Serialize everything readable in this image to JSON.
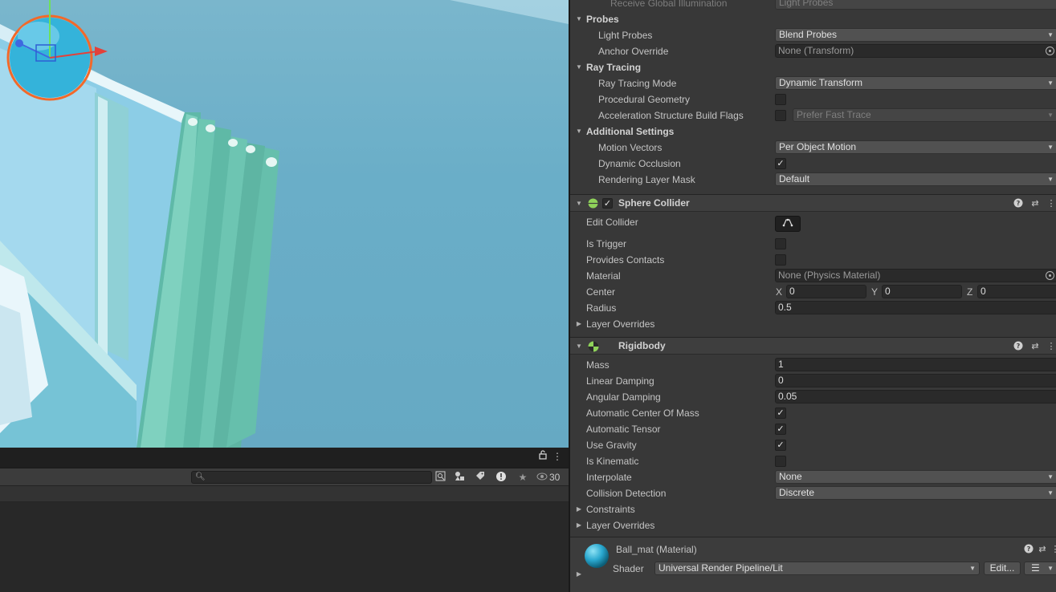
{
  "scene": {
    "icons": {
      "gizmo": "sphere-gizmo-icon"
    },
    "colors": {
      "sky": "#6aaec8",
      "radiator": "#6fc4b4",
      "selection": "#f26b22",
      "sphere": "#3bb5dc"
    }
  },
  "bottom_panel": {
    "lock_icon": "lock-icon",
    "menu_icon": "kebab-menu-icon",
    "search": {
      "value": "",
      "placeholder": ""
    },
    "hidden_count": "30",
    "toolbar_icons": [
      "search-filter-icon",
      "type-filter-icon",
      "label-filter-icon",
      "error-filter-icon",
      "favorite-filter-icon",
      "visibility-icon"
    ]
  },
  "inspector": {
    "renderer": {
      "receive_gi": {
        "label": "Receive Global Illumination",
        "value": "Light Probes"
      },
      "probes": {
        "header": "Probes",
        "light_probes": {
          "label": "Light Probes",
          "value": "Blend Probes"
        },
        "anchor_override": {
          "label": "Anchor Override",
          "value": "None (Transform)"
        }
      },
      "ray_tracing": {
        "header": "Ray Tracing",
        "mode": {
          "label": "Ray Tracing Mode",
          "value": "Dynamic Transform"
        },
        "procedural": {
          "label": "Procedural Geometry",
          "checked": false
        },
        "accel": {
          "label": "Acceleration Structure Build Flags",
          "value": "Prefer Fast Trace",
          "checked": false
        }
      },
      "additional": {
        "header": "Additional Settings",
        "motion_vectors": {
          "label": "Motion Vectors",
          "value": "Per Object Motion"
        },
        "dynamic_occlusion": {
          "label": "Dynamic Occlusion",
          "checked": true
        },
        "rendering_layer_mask": {
          "label": "Rendering Layer Mask",
          "value": "Default"
        }
      }
    },
    "sphere_collider": {
      "title": "Sphere Collider",
      "enabled": true,
      "edit_collider": {
        "label": "Edit Collider"
      },
      "is_trigger": {
        "label": "Is Trigger",
        "checked": false
      },
      "provides_contacts": {
        "label": "Provides Contacts",
        "checked": false
      },
      "material": {
        "label": "Material",
        "value": "None (Physics Material)"
      },
      "center": {
        "label": "Center",
        "x_label": "X",
        "x": "0",
        "y_label": "Y",
        "y": "0",
        "z_label": "Z",
        "z": "0"
      },
      "radius": {
        "label": "Radius",
        "value": "0.5"
      },
      "layer_overrides": {
        "label": "Layer Overrides"
      }
    },
    "rigidbody": {
      "title": "Rigidbody",
      "mass": {
        "label": "Mass",
        "value": "1"
      },
      "linear_damping": {
        "label": "Linear Damping",
        "value": "0"
      },
      "angular_damping": {
        "label": "Angular Damping",
        "value": "0.05"
      },
      "auto_center": {
        "label": "Automatic Center Of Mass",
        "checked": true
      },
      "auto_tensor": {
        "label": "Automatic Tensor",
        "checked": true
      },
      "use_gravity": {
        "label": "Use Gravity",
        "checked": true
      },
      "is_kinematic": {
        "label": "Is Kinematic",
        "checked": false
      },
      "interpolate": {
        "label": "Interpolate",
        "value": "None"
      },
      "collision_detection": {
        "label": "Collision Detection",
        "value": "Discrete"
      },
      "constraints": {
        "label": "Constraints"
      },
      "layer_overrides": {
        "label": "Layer Overrides"
      }
    },
    "material": {
      "name": "Ball_mat (Material)",
      "shader_label": "Shader",
      "shader_value": "Universal Render Pipeline/Lit",
      "edit_button": "Edit...",
      "list_icon": "list-icon"
    },
    "header_icons": [
      "help-icon",
      "presets-icon",
      "kebab-menu-icon"
    ]
  }
}
